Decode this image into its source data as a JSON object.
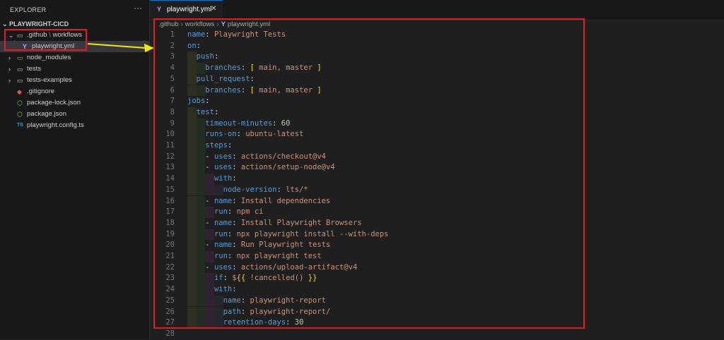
{
  "explorer": {
    "header": "EXPLORER",
    "more": "···",
    "root": "PLAYWRIGHT-CICD",
    "items": [
      {
        "label": ".github",
        "label2": "workflows",
        "type": "folder",
        "expanded": true,
        "icon": "folder-icon"
      },
      {
        "label": "playwright.yml",
        "type": "yml",
        "icon": "yaml-file-icon",
        "selected": true
      },
      {
        "label": "node_modules",
        "type": "folder",
        "icon": "npm-folder-icon"
      },
      {
        "label": "tests",
        "type": "folder",
        "icon": "folder-icon"
      },
      {
        "label": "tests-examples",
        "type": "folder",
        "icon": "folder-icon"
      },
      {
        "label": ".gitignore",
        "type": "file",
        "icon": "git-icon"
      },
      {
        "label": "package-lock.json",
        "type": "file",
        "icon": "npm-json-icon"
      },
      {
        "label": "package.json",
        "type": "file",
        "icon": "npm-json-icon"
      },
      {
        "label": "playwright.config.ts",
        "type": "file",
        "icon": "typescript-icon"
      }
    ]
  },
  "tab": {
    "label": "playwright.yml",
    "icon_text": "Y",
    "close": "✕"
  },
  "breadcrumb": [
    ".github",
    "workflows",
    "playwright.yml"
  ],
  "code_lines": [
    "name: Playwright Tests",
    "on:",
    "  push:",
    "    branches: [ main, master ]",
    "  pull_request:",
    "    branches: [ main, master ]",
    "jobs:",
    "  test:",
    "    timeout-minutes: 60",
    "    runs-on: ubuntu-latest",
    "    steps:",
    "    - uses: actions/checkout@v4",
    "    - uses: actions/setup-node@v4",
    "      with:",
    "        node-version: lts/*",
    "    - name: Install dependencies",
    "      run: npm ci",
    "    - name: Install Playwright Browsers",
    "      run: npx playwright install --with-deps",
    "    - name: Run Playwright tests",
    "      run: npx playwright test",
    "    - uses: actions/upload-artifact@v4",
    "      if: ${{ !cancelled() }}",
    "      with:",
    "        name: playwright-report",
    "        path: playwright-report/",
    "        retention-days: 30",
    ""
  ],
  "colors": {
    "highlight": "#e31b23",
    "arrow": "#f5e800",
    "accent": "#0078d4"
  }
}
